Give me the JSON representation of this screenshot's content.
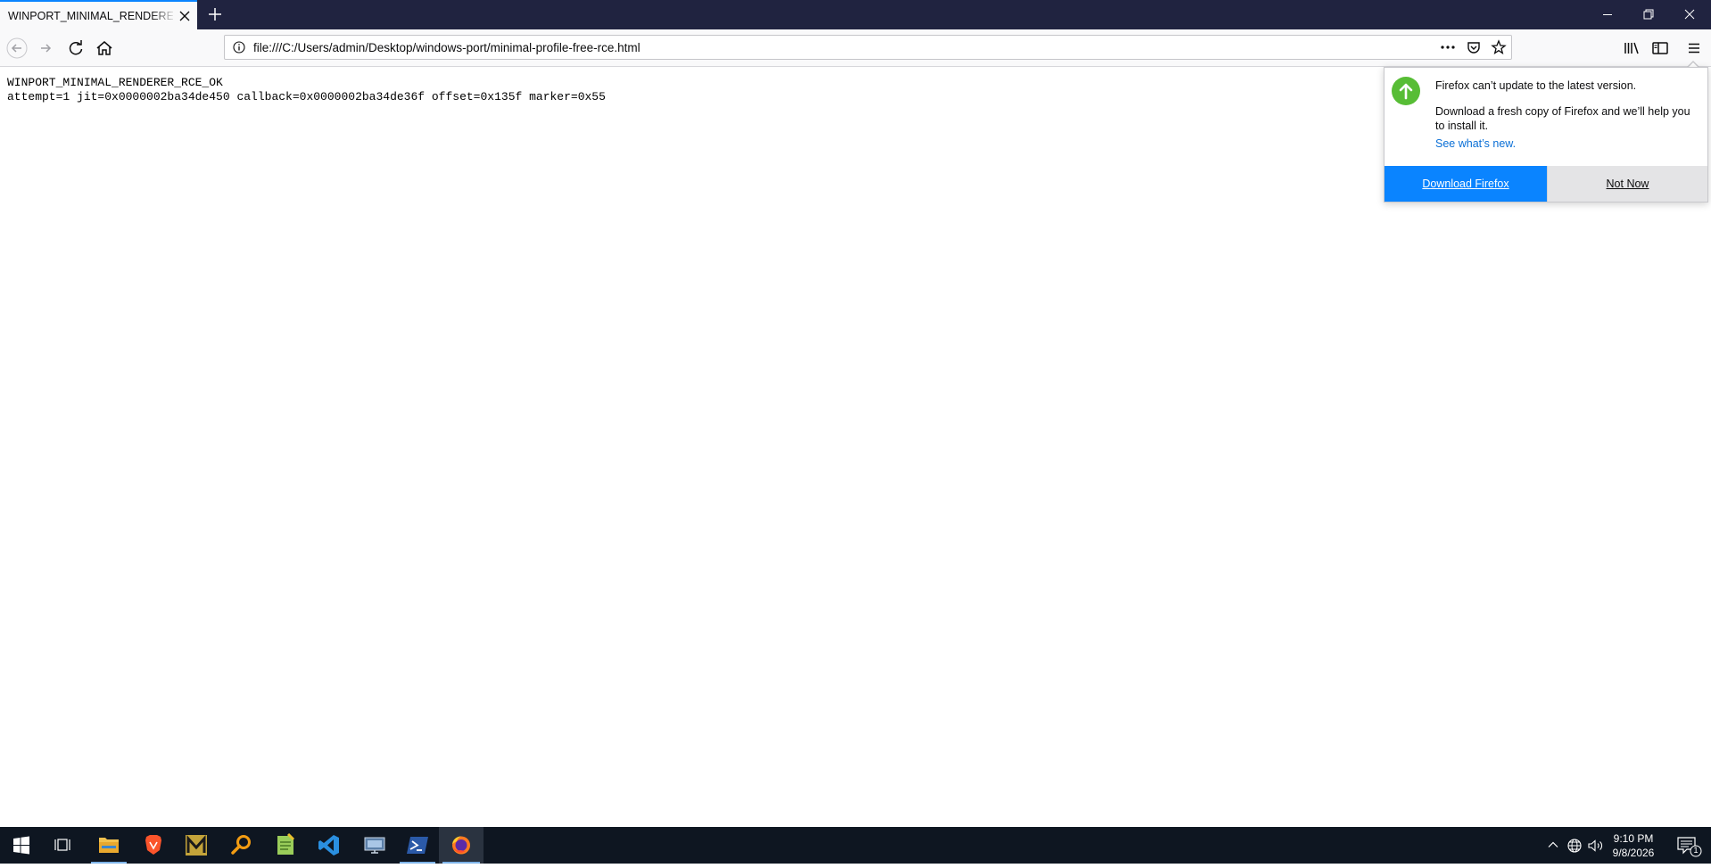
{
  "browser": {
    "tab_title": "WINPORT_MINIMAL_RENDERER_RCE_OK",
    "url": "file:///C:/Users/admin/Desktop/windows-port/minimal-profile-free-rce.html"
  },
  "page": {
    "lines": [
      "WINPORT_MINIMAL_RENDERER_RCE_OK",
      "attempt=1 jit=0x0000002ba34de450 callback=0x0000002ba34de36f offset=0x135f marker=0x55"
    ]
  },
  "update_panel": {
    "title": "Firefox can’t update to the latest version.",
    "description": "Download a fresh copy of Firefox and we’ll help you to install it.",
    "link": "See what’s new.",
    "primary_button": "Download Firefox",
    "secondary_button": "Not Now",
    "icon": "arrow-up-icon",
    "accent_color": "#0a84ff",
    "icon_color": "#57bd35"
  },
  "taskbar": {
    "apps": [
      "start-icon",
      "task-view-icon",
      "file-explorer-icon",
      "brave-icon",
      "m-app-icon",
      "search-app-icon",
      "notepad-icon",
      "vscode-icon",
      "remote-desktop-icon",
      "powershell-icon",
      "firefox-icon"
    ],
    "time": "9:10 PM",
    "date": "9/8/2026",
    "notification_count": "1"
  }
}
